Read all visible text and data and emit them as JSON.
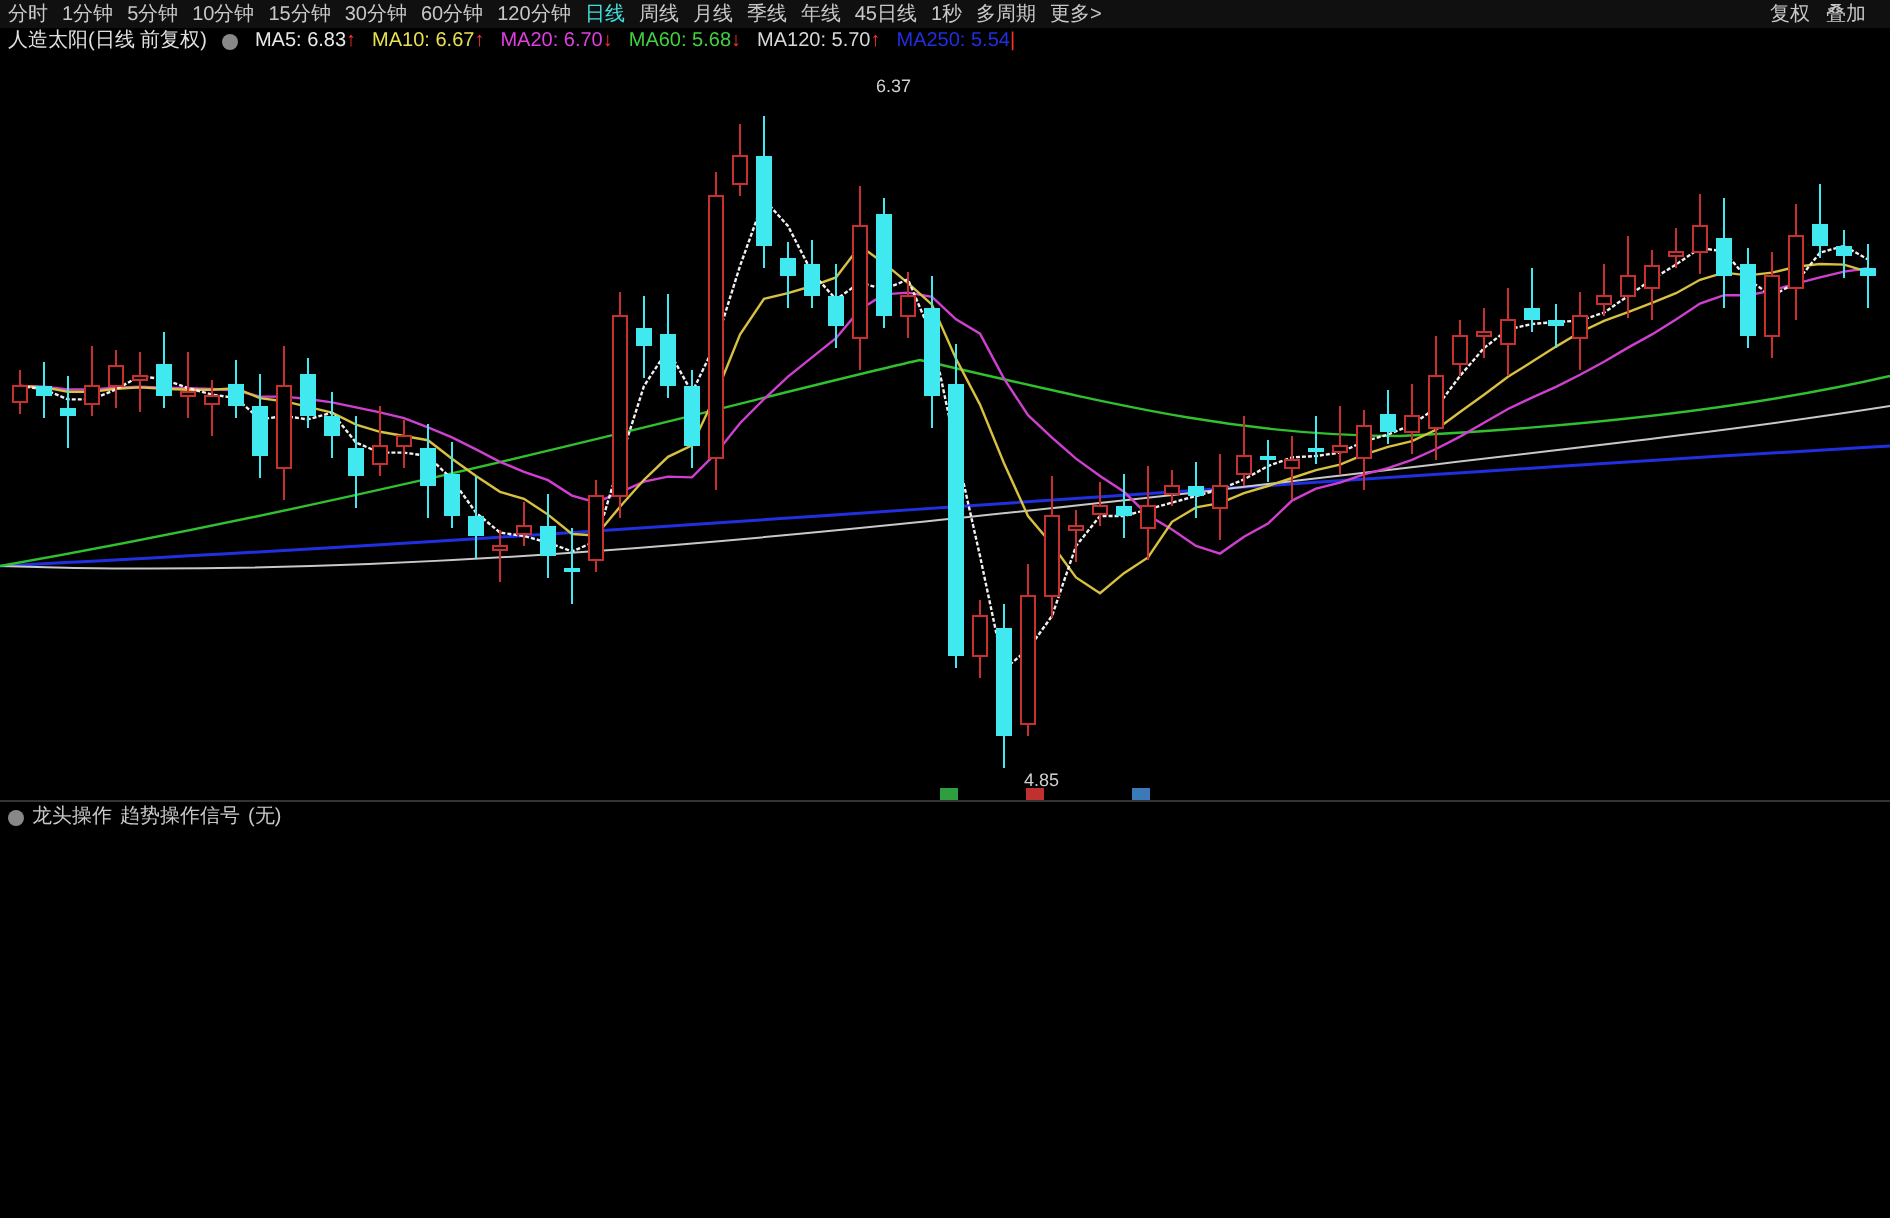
{
  "period_tabs": [
    {
      "label": "分时",
      "selected": false
    },
    {
      "label": "1分钟",
      "selected": false
    },
    {
      "label": "5分钟",
      "selected": false
    },
    {
      "label": "10分钟",
      "selected": false
    },
    {
      "label": "15分钟",
      "selected": false
    },
    {
      "label": "30分钟",
      "selected": false
    },
    {
      "label": "60分钟",
      "selected": false
    },
    {
      "label": "120分钟",
      "selected": false
    },
    {
      "label": "日线",
      "selected": true
    },
    {
      "label": "周线",
      "selected": false
    },
    {
      "label": "月线",
      "selected": false
    },
    {
      "label": "季线",
      "selected": false
    },
    {
      "label": "年线",
      "selected": false
    },
    {
      "label": "45日线",
      "selected": false
    },
    {
      "label": "1秒",
      "selected": false
    },
    {
      "label": "多周期",
      "selected": false
    },
    {
      "label": "更多>",
      "selected": false
    }
  ],
  "toolbar_right": [
    "复权",
    "叠加"
  ],
  "main_panel": {
    "title": "人造太阳(日线 前复权)",
    "indicators": [
      {
        "label": "MA5: 6.83",
        "arrow": "↑",
        "color": "#e8e8e8"
      },
      {
        "label": "MA10: 6.67",
        "arrow": "↑",
        "color": "#e8e050"
      },
      {
        "label": "MA20: 6.70",
        "arrow": "↓",
        "color": "#e040e0"
      },
      {
        "label": "MA60: 5.68",
        "arrow": "↓",
        "color": "#40d040"
      },
      {
        "label": "MA120: 5.70",
        "arrow": "↑",
        "color": "#d8d8d8"
      },
      {
        "label": "MA250: 5.54",
        "arrow": "|",
        "color": "#2030e0"
      }
    ],
    "high_label": "6.37",
    "low_label": "4.85",
    "signals": [
      {
        "color": "#2e9e3e"
      },
      {
        "color": "#c03030"
      },
      {
        "color": "#3a7ab8"
      }
    ]
  },
  "sub_panel": {
    "title": "龙头操作",
    "subtitle": "趋势操作信号",
    "value": "(无)"
  }
}
